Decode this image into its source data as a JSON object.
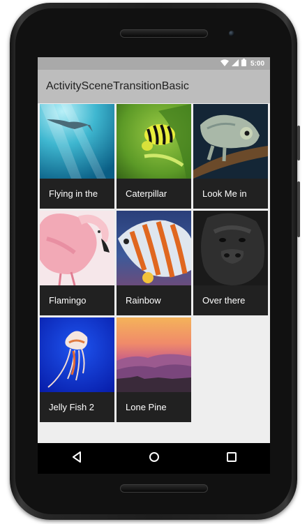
{
  "status_bar": {
    "time": "5:00"
  },
  "app_bar": {
    "title": "ActivitySceneTransitionBasic"
  },
  "grid": {
    "items": [
      {
        "label": "Flying in the",
        "image": "manta-ray-underwater"
      },
      {
        "label": "Caterpillar",
        "image": "caterpillar-on-leaf"
      },
      {
        "label": "Look Me in",
        "image": "chameleon-on-branch"
      },
      {
        "label": "Flamingo",
        "image": "pink-flamingo"
      },
      {
        "label": "Rainbow",
        "image": "striped-tropical-fish"
      },
      {
        "label": "Over there",
        "image": "gorilla-face"
      },
      {
        "label": "Jelly Fish 2",
        "image": "jellyfish-blue-water"
      },
      {
        "label": "Lone Pine",
        "image": "sunset-mountains"
      }
    ]
  },
  "nav_bar": {
    "icons": [
      "back-icon",
      "home-icon",
      "recents-icon"
    ]
  },
  "colors": {
    "status_bar": "#a9a9a9",
    "app_bar": "#bdbdbd",
    "background": "#eeeeee",
    "tile": "#212121",
    "caption_text": "#ffffff"
  }
}
